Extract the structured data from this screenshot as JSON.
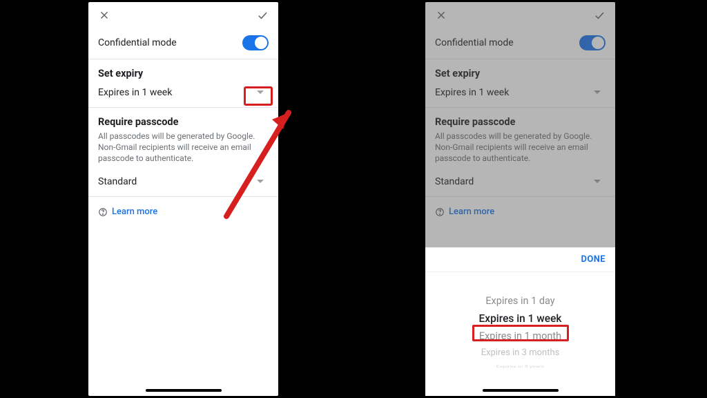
{
  "header": {
    "confidential_label": "Confidential mode",
    "toggle_on": true
  },
  "expiry": {
    "title": "Set expiry",
    "value": "Expires in 1 week"
  },
  "passcode": {
    "title": "Require passcode",
    "description": "All passcodes will be generated by Google. Non-Gmail recipients will receive an email passcode to authenticate.",
    "value": "Standard"
  },
  "learn_more": "Learn more",
  "picker": {
    "done_label": "DONE",
    "options": [
      "Expires in 1 day",
      "Expires in 1 week",
      "Expires in 1 month",
      "Expires in 3 months",
      "Expires in 5 years"
    ],
    "selected_index": 1
  }
}
